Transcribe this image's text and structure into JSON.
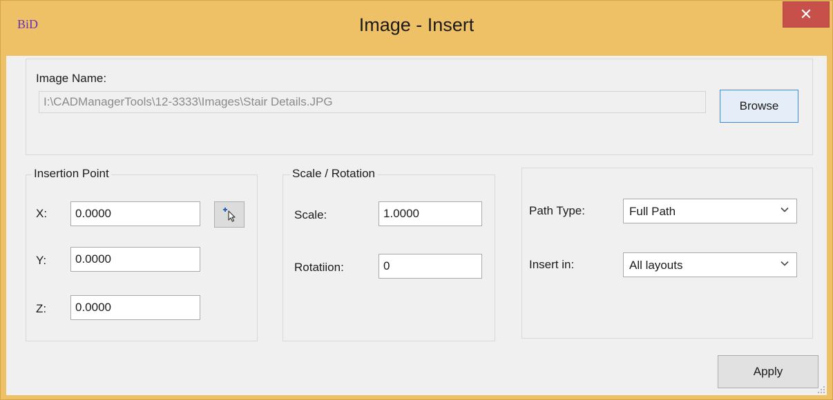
{
  "window": {
    "logo": "BiD",
    "title": "Image - Insert",
    "close_glyph": "✕"
  },
  "image_name": {
    "label": "Image Name:",
    "path": "I:\\CADManagerTools\\12-3333\\Images\\Stair Details.JPG",
    "browse_label": "Browse"
  },
  "insertion_point": {
    "group_label": "Insertion Point",
    "x_label": "X:",
    "x_value": "0.0000",
    "y_label": "Y:",
    "y_value": "0.0000",
    "z_label": "Z:",
    "z_value": "0.0000",
    "pick_icon": "pick-point-icon"
  },
  "scale_rotation": {
    "group_label": "Scale / Rotation",
    "scale_label": "Scale:",
    "scale_value": "1.0000",
    "rotation_label": "Rotatiion:",
    "rotation_value": "0"
  },
  "options": {
    "path_type_label": "Path Type:",
    "path_type_value": "Full Path",
    "insert_in_label": "Insert in:",
    "insert_in_value": "All layouts"
  },
  "footer": {
    "apply_label": "Apply"
  },
  "colors": {
    "titlebar": "#efc166",
    "close_button": "#c7504a",
    "logo": "#6a2fc0",
    "client_background": "#f0f0f0",
    "focus_border": "#3a8ad8"
  }
}
